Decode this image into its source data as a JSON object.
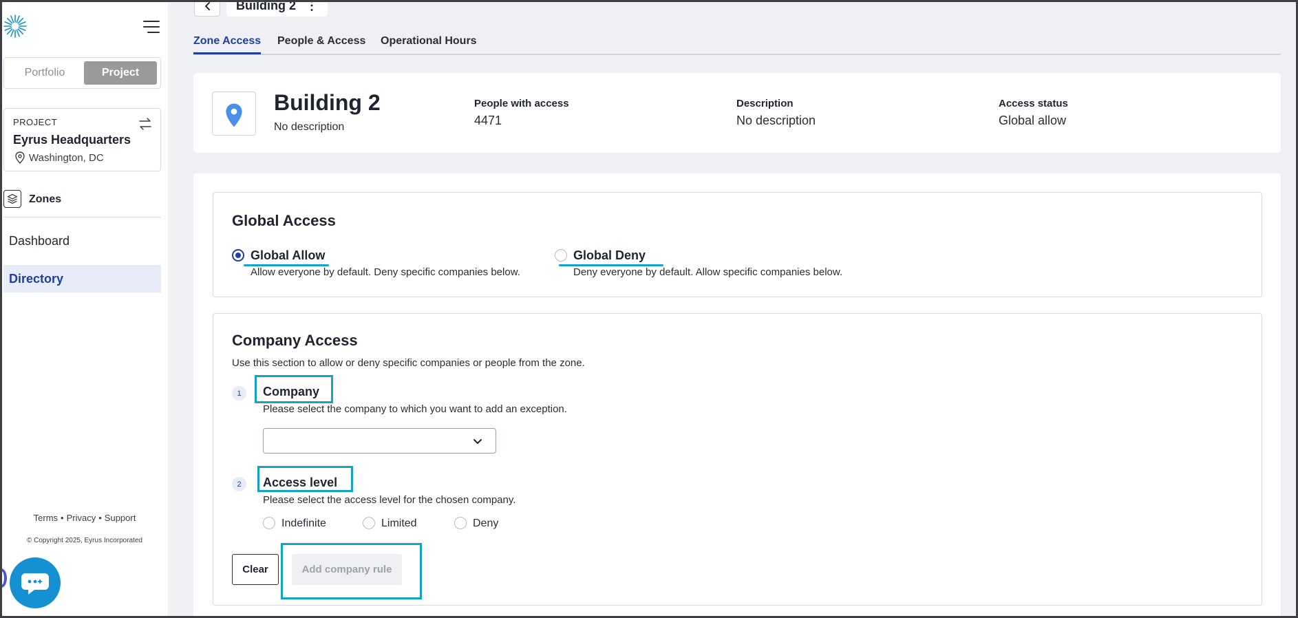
{
  "sidebar": {
    "logo": "eyrus-logo",
    "menu_icon": "hamburger-icon",
    "segment": {
      "portfolio": "Portfolio",
      "project": "Project",
      "selected": "Project"
    },
    "project": {
      "label": "PROJECT",
      "name": "Eyrus Headquarters",
      "location": "Washington, DC",
      "location_icon": "map-pin-icon",
      "switch_icon": "swap-arrows-icon"
    },
    "zones": {
      "label": "Zones",
      "icon": "layers-icon"
    },
    "nav": [
      {
        "label": "Dashboard",
        "active": false
      },
      {
        "label": "Directory",
        "active": true
      }
    ],
    "footer": {
      "terms": "Terms",
      "privacy": "Privacy",
      "support": "Support",
      "copyright": "© Copyright 2025, Eyrus Incorporated"
    },
    "chat_icon": "chat-bubble-icon"
  },
  "topbar": {
    "back_icon": "chevron-left-icon",
    "crumb": "Building 2",
    "more_icon": "kebab-icon"
  },
  "tabs": [
    {
      "label": "Zone Access",
      "active": true
    },
    {
      "label": "People & Access",
      "active": false
    },
    {
      "label": "Operational Hours",
      "active": false
    }
  ],
  "building": {
    "name": "Building 2",
    "description": "No description",
    "icon": "map-pin-icon",
    "stats": [
      {
        "label": "People with access",
        "value": "4471"
      },
      {
        "label": "Description",
        "value": "No description"
      },
      {
        "label": "Access status",
        "value": "Global allow"
      }
    ]
  },
  "global_access": {
    "title": "Global Access",
    "selected": "Global Allow",
    "options": [
      {
        "label": "Global Allow",
        "description": "Allow everyone by default. Deny specific companies below."
      },
      {
        "label": "Global Deny",
        "description": "Deny everyone by default. Allow specific companies below."
      }
    ]
  },
  "company_access": {
    "title": "Company Access",
    "intro": "Use this section to allow or deny specific companies or people from the zone.",
    "steps": [
      {
        "number": "1",
        "title": "Company",
        "description": "Please select the company to which you want to add an exception."
      },
      {
        "number": "2",
        "title": "Access level",
        "description": "Please select the access level for the chosen company."
      }
    ],
    "company_select_value": "",
    "access_levels": [
      "Indefinite",
      "Limited",
      "Deny"
    ],
    "buttons": {
      "clear": "Clear",
      "add": "Add company rule"
    }
  },
  "colors": {
    "accent": "#1d3fa6",
    "annotation": "#14a3c8",
    "chat": "#1590d3"
  }
}
